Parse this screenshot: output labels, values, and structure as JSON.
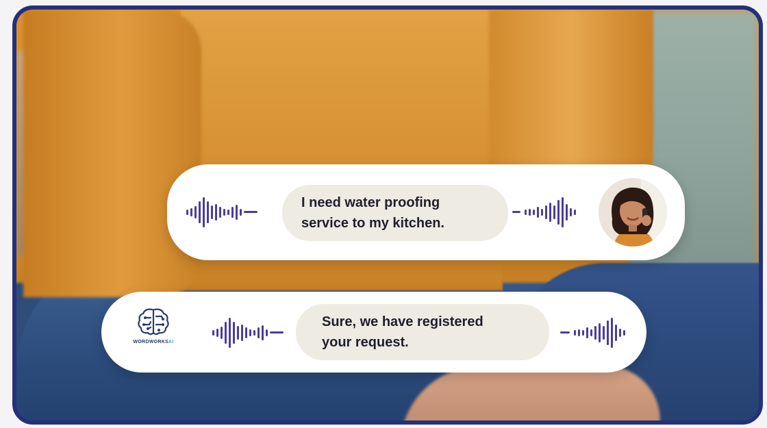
{
  "conversation": {
    "user_message": {
      "line1": "I need water proofing",
      "line2": "service to my kitchen."
    },
    "bot_reply": {
      "line1": "Sure, we have registered",
      "line2": "your request."
    }
  },
  "brand": {
    "logo_name": "WORDWORKS",
    "logo_suffix": "AI"
  },
  "icons": {
    "user_avatar": "woman-on-phone-avatar",
    "bot_logo": "ai-brain-circuit-icon",
    "waveform": "audio-waveform-icon"
  },
  "colors": {
    "frame_border": "#25307a",
    "waveform": "#4a3d9a",
    "text_pill": "#eeebe3",
    "bubble": "#ffffff"
  }
}
